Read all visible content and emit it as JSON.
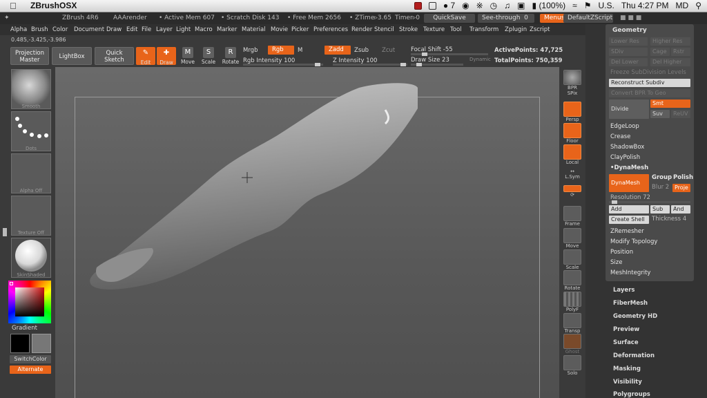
{
  "mac_menubar": {
    "app_name": "ZBrushOSX",
    "badge_count": "7",
    "battery": "(100%)",
    "flag_label": "U.S.",
    "clock": "Thu 4:27 PM",
    "user": "MD"
  },
  "titlebar": {
    "version": "ZBrush 4R6",
    "render": "AAArender",
    "active_mem": "• Active Mem 607",
    "scratch_disk": "• Scratch Disk 143",
    "free_mem": "• Free Mem 2656",
    "ztime": "• ZTime▹3.65",
    "timer": "Timer▹0",
    "quicksave": "QuickSave",
    "see_through": "See-through",
    "see_through_value": "0",
    "menus": "Menus",
    "default_zscript": "DefaultZScript"
  },
  "main_menu": [
    "Alpha",
    "Brush",
    "Color",
    "Document",
    "Draw",
    "Edit",
    "File",
    "Layer",
    "Light",
    "Macro",
    "Marker",
    "Material",
    "Movie",
    "Picker",
    "Preferences",
    "Render",
    "Stencil",
    "Stroke",
    "Texture",
    "Tool",
    "Transform",
    "Zplugin",
    "Zscript"
  ],
  "toolbar": {
    "coords": "0.485,-3.425,-3.986",
    "projection_master": "Projection Master",
    "lightbox": "LightBox",
    "quick_sketch": "Quick Sketch",
    "edit": "Edit",
    "draw": "Draw",
    "move": "Move",
    "scale": "Scale",
    "rotate": "Rotate",
    "mrgb": "Mrgb",
    "rgb": "Rgb",
    "m": "M",
    "zadd": "Zadd",
    "zsub": "Zsub",
    "zcut": "Zcut",
    "rgb_intensity": "Rgb Intensity 100",
    "z_intensity": "Z Intensity 100",
    "focal_shift": "Focal Shift -55",
    "draw_size": "Draw Size 23",
    "dynamic": "Dynamic",
    "active_points": "ActivePoints: 47,725",
    "total_points": "TotalPoints: 750,359"
  },
  "left_shelf": {
    "brush_thumb": "Smooth",
    "stroke_thumb": "Dots",
    "alpha_thumb": "Alpha Off",
    "texture_thumb": "Texture Off",
    "material_thumb": "SkinShaded",
    "gradient": "Gradient",
    "switch_color": "SwitchColor",
    "alternate": "Alternate"
  },
  "right_shelf": [
    "BPR",
    "SPix",
    "Persp",
    "Floor",
    "Local",
    "L.Sym",
    "Gxyz",
    "Frame",
    "Move",
    "Scale",
    "Rotate",
    "PolyF",
    "Transp",
    "Ghost",
    "Solo"
  ],
  "geometry_panel": {
    "title": "Geometry",
    "lower_res": "Lower Res",
    "higher_res": "Higher Res",
    "sdiv": "SDiv",
    "cage": "Cage",
    "rstr": "Rstr",
    "del_lower": "Del Lower",
    "del_higher": "Del Higher",
    "freeze_subdivision": "Freeze SubDivision Levels",
    "reconstruct_subdiv": "Reconstruct Subdiv",
    "convert_bpr": "Convert BPR To Geo",
    "divide": "Divide",
    "smt": "Smt",
    "suv": "Suv",
    "reuv": "ReUV",
    "edgeloop": "EdgeLoop",
    "crease": "Crease",
    "shadowbox": "ShadowBox",
    "claypolish": "ClayPolish",
    "dynamesh_header": "DynaMesh",
    "dynamesh_btn": "DynaMesh",
    "group": "Group",
    "polish": "Polish",
    "blur": "Blur",
    "blur_value": "2",
    "project": "Proje",
    "resolution": "Resolution 72",
    "add": "Add",
    "sub": "Sub",
    "and": "And",
    "create_shell": "Create Shell",
    "thickness": "Thickness 4",
    "zremesher": "ZRemesher",
    "modify_topology": "Modify Topology",
    "position": "Position",
    "size": "Size",
    "mesh_integrity": "MeshIntegrity"
  },
  "tool_subpalettes": [
    "Layers",
    "FiberMesh",
    "Geometry HD",
    "Preview",
    "Surface",
    "Deformation",
    "Masking",
    "Visibility",
    "Polygroups"
  ],
  "colors": {
    "accent": "#e8641a",
    "panel": "#4a4a4a",
    "background": "#3a3a3a"
  }
}
